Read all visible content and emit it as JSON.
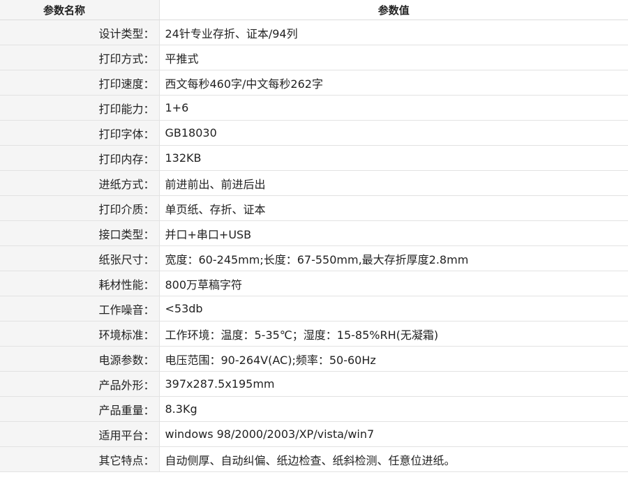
{
  "header": {
    "name_label": "参数名称",
    "value_label": "参数值"
  },
  "rows": [
    {
      "name": "设计类型：",
      "value": "24针专业存折、证本/94列"
    },
    {
      "name": "打印方式：",
      "value": "平推式"
    },
    {
      "name": "打印速度：",
      "value": "西文每秒460字/中文每秒262字"
    },
    {
      "name": "打印能力：",
      "value": "1+6"
    },
    {
      "name": "打印字体：",
      "value": "GB18030"
    },
    {
      "name": "打印内存：",
      "value": "132KB"
    },
    {
      "name": "进纸方式：",
      "value": "前进前出、前进后出"
    },
    {
      "name": "打印介质：",
      "value": "单页纸、存折、证本"
    },
    {
      "name": "接口类型：",
      "value": "并口+串口+USB"
    },
    {
      "name": "纸张尺寸：",
      "value": "宽度：60-245mm;长度：67-550mm,最大存折厚度2.8mm"
    },
    {
      "name": "耗材性能：",
      "value": "800万草稿字符"
    },
    {
      "name": "工作噪音：",
      "value": "<53db"
    },
    {
      "name": "环境标准：",
      "value": "工作环境：温度：5-35℃；湿度：15-85%RH(无凝霜)"
    },
    {
      "name": "电源参数：",
      "value": "电压范围：90-264V(AC);频率：50-60Hz"
    },
    {
      "name": "产品外形：",
      "value": "397x287.5x195mm"
    },
    {
      "name": "产品重量：",
      "value": "8.3Kg"
    },
    {
      "name": "适用平台：",
      "value": "windows 98/2000/2003/XP/vista/win7"
    },
    {
      "name": "其它特点：",
      "value": "自动侧厚、自动纠偏、纸边检查、纸斜检测、任意位进纸。"
    }
  ]
}
